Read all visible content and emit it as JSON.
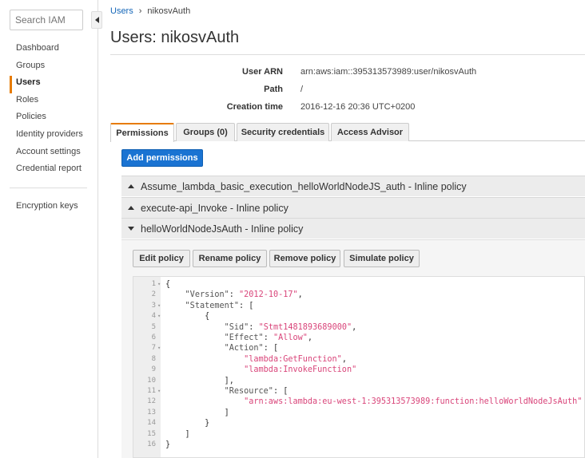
{
  "sidebar": {
    "search_placeholder": "Search IAM",
    "items": [
      {
        "label": "Dashboard"
      },
      {
        "label": "Groups"
      },
      {
        "label": "Users"
      },
      {
        "label": "Roles"
      },
      {
        "label": "Policies"
      },
      {
        "label": "Identity providers"
      },
      {
        "label": "Account settings"
      },
      {
        "label": "Credential report"
      }
    ],
    "extra_item": "Encryption keys"
  },
  "breadcrumb": {
    "root": "Users",
    "current": "nikosvAuth"
  },
  "page": {
    "title": "Users: nikosvAuth"
  },
  "summary": {
    "arn_label": "User ARN",
    "arn_value": "arn:aws:iam::395313573989:user/nikosvAuth",
    "path_label": "Path",
    "path_value": "/",
    "created_label": "Creation time",
    "created_value": "2016-12-16 20:36 UTC+0200"
  },
  "tabs": [
    {
      "label": "Permissions"
    },
    {
      "label": "Groups (0)"
    },
    {
      "label": "Security credentials"
    },
    {
      "label": "Access Advisor"
    }
  ],
  "add_permissions_label": "Add permissions",
  "policies": [
    {
      "name": "Assume_lambda_basic_execution_helloWorldNodeJS_auth - Inline policy",
      "expanded": false
    },
    {
      "name": "execute-api_Invoke - Inline policy",
      "expanded": false
    },
    {
      "name": "helloWorldNodeJsAuth - Inline policy",
      "expanded": true
    }
  ],
  "policy_actions": {
    "edit": "Edit policy",
    "rename": "Rename policy",
    "remove": "Remove policy",
    "simulate": "Simulate policy"
  },
  "code_lines": [
    "{",
    "    \"Version\": \"2012-10-17\",",
    "    \"Statement\": [",
    "        {",
    "            \"Sid\": \"Stmt1481893689000\",",
    "            \"Effect\": \"Allow\",",
    "            \"Action\": [",
    "                \"lambda:GetFunction\",",
    "                \"lambda:InvokeFunction\"",
    "            ],",
    "            \"Resource\": [",
    "                \"arn:aws:lambda:eu-west-1:395313573989:function:helloWorldNodeJsAuth\"",
    "            ]",
    "        }",
    "    ]",
    "}"
  ],
  "colors": {
    "accent": "#e77b00",
    "primary_button": "#1a73d2",
    "json_string": "#d9457a"
  }
}
